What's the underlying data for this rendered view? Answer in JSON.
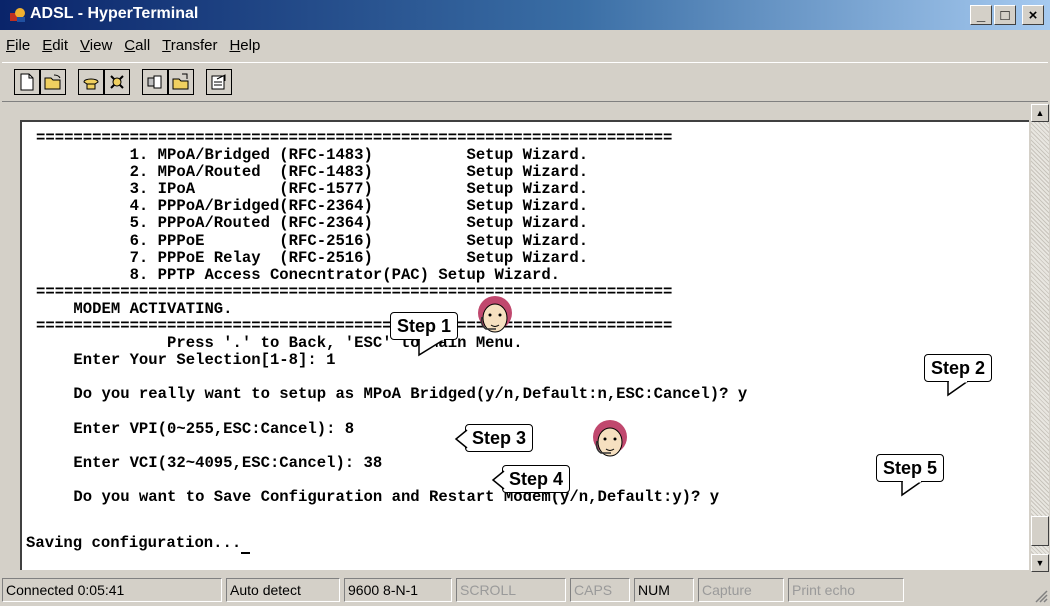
{
  "window": {
    "title": "ADSL - HyperTerminal",
    "buttons": {
      "minimize": "_",
      "maximize": "□",
      "close": "×"
    }
  },
  "menu": [
    {
      "ul": "F",
      "rest": "ile"
    },
    {
      "ul": "E",
      "rest": "dit"
    },
    {
      "ul": "V",
      "rest": "iew"
    },
    {
      "ul": "C",
      "rest": "all"
    },
    {
      "ul": "T",
      "rest": "ransfer"
    },
    {
      "ul": "H",
      "rest": "elp"
    }
  ],
  "terminal": {
    "lines": "====================================================================\n          1. MPoA/Bridged (RFC-1483)          Setup Wizard.\n          2. MPoA/Routed  (RFC-1483)          Setup Wizard.\n          3. IPoA         (RFC-1577)          Setup Wizard.\n          4. PPPoA/Bridged(RFC-2364)          Setup Wizard.\n          5. PPPoA/Routed (RFC-2364)          Setup Wizard.\n          6. PPPoE        (RFC-2516)          Setup Wizard.\n          7. PPPoE Relay  (RFC-2516)          Setup Wizard.\n          8. PPTP Access Conecntrator(PAC) Setup Wizard.\n====================================================================\n    MODEM ACTIVATING.\n====================================================================\n              Press '.' to Back, 'ESC' to Main Menu.\n    Enter Your Selection[1-8]: 1\n\n    Do you really want to setup as MPoA Bridged(y/n,Default:n,ESC:Cancel)? y\n\n    Enter VPI(0~255,ESC:Cancel): 8\n\n    Enter VCI(32~4095,ESC:Cancel): 38\n\n    Do you want to Save Configuration and Restart Modem(y/n,Default:y)? y\n",
    "last_line": "Saving configuration..."
  },
  "callouts": {
    "step1": "Step 1",
    "step2": "Step 2",
    "step3": "Step 3",
    "step4": "Step 4",
    "step5": "Step 5"
  },
  "status": {
    "connected": "Connected 0:05:41",
    "detect": "Auto detect",
    "settings": "9600 8-N-1",
    "scroll": "SCROLL",
    "caps": "CAPS",
    "num": "NUM",
    "capture": "Capture",
    "print_echo": "Print echo"
  }
}
